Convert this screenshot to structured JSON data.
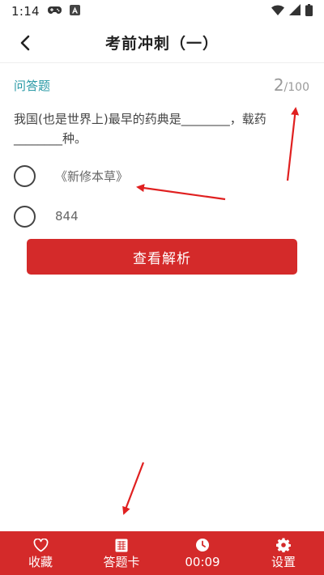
{
  "status_bar": {
    "time": "1:14",
    "icons": [
      "gamepad-icon",
      "a-notification-icon",
      "wifi-icon",
      "signal-icon",
      "battery-icon"
    ]
  },
  "header": {
    "title": "考前冲刺（一）",
    "back_icon": "chevron-left-icon"
  },
  "question": {
    "type_label": "问答题",
    "current": "2",
    "total": "/100",
    "text": "我国(也是世界上)最早的药典是________，载药________种。",
    "options": [
      {
        "label": "《新修本草》"
      },
      {
        "label": "844"
      }
    ],
    "analysis_button": "查看解析"
  },
  "bottom_bar": {
    "items": [
      {
        "label": "收藏",
        "icon": "heart-icon"
      },
      {
        "label": "答题卡",
        "icon": "grid-card-icon"
      },
      {
        "label": "00:09",
        "icon": "clock-icon"
      },
      {
        "label": "设置",
        "icon": "gear-icon"
      }
    ]
  },
  "colors": {
    "accent_red": "#d42a2a",
    "teal_label": "#2a9aa6",
    "annotation_arrow": "#e02020"
  }
}
